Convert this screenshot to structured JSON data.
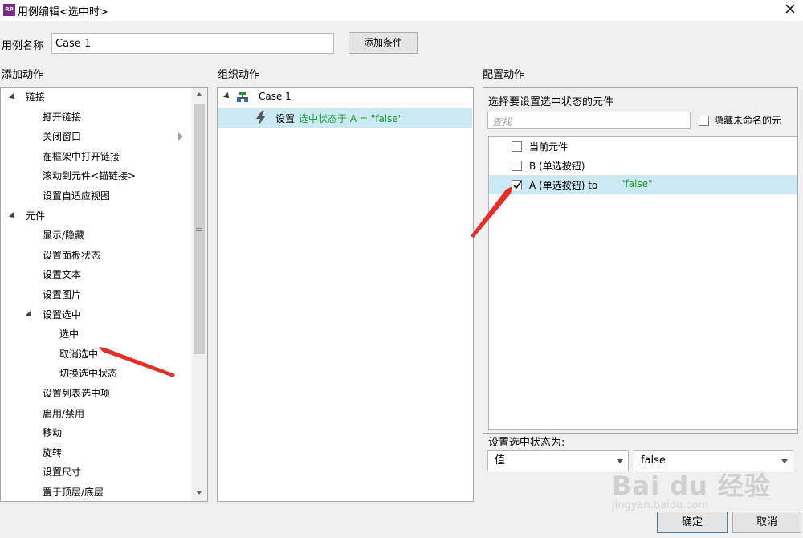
{
  "window": {
    "icon_text": "RP",
    "title": "用例编辑<选中时>",
    "close_label": "✕"
  },
  "case_name": {
    "label": "用例名称",
    "value": "Case 1",
    "add_condition_label": "添加条件"
  },
  "add_actions": {
    "title": "添加动作",
    "tree": [
      {
        "label": "链接",
        "level": 0,
        "state": "expanded"
      },
      {
        "label": "打开链接",
        "level": 1,
        "state": "collapsed"
      },
      {
        "label": "关闭窗口",
        "level": 1,
        "state": "none"
      },
      {
        "label": "在框架中打开链接",
        "level": 1,
        "state": "collapsed"
      },
      {
        "label": "滚动到元件<锚链接>",
        "level": 1,
        "state": "none"
      },
      {
        "label": "设置自适应视图",
        "level": 1,
        "state": "none"
      },
      {
        "label": "元件",
        "level": 0,
        "state": "expanded"
      },
      {
        "label": "显示/隐藏",
        "level": 1,
        "state": "collapsed"
      },
      {
        "label": "设置面板状态",
        "level": 1,
        "state": "none"
      },
      {
        "label": "设置文本",
        "level": 1,
        "state": "none"
      },
      {
        "label": "设置图片",
        "level": 1,
        "state": "none"
      },
      {
        "label": "设置选中",
        "level": 1,
        "state": "expanded"
      },
      {
        "label": "选中",
        "level": 2,
        "state": "none"
      },
      {
        "label": "取消选中",
        "level": 2,
        "state": "none"
      },
      {
        "label": "切换选中状态",
        "level": 2,
        "state": "none"
      },
      {
        "label": "设置列表选中项",
        "level": 1,
        "state": "none"
      },
      {
        "label": "启用/禁用",
        "level": 1,
        "state": "collapsed"
      },
      {
        "label": "移动",
        "level": 1,
        "state": "none"
      },
      {
        "label": "旋转",
        "level": 1,
        "state": "none"
      },
      {
        "label": "设置尺寸",
        "level": 1,
        "state": "none"
      },
      {
        "label": "置于顶层/底层",
        "level": 1,
        "state": "collapsed"
      }
    ]
  },
  "organize_actions": {
    "title": "组织动作",
    "case_label": "Case 1",
    "action_prefix": "设置",
    "action_detail": "选中状态于 A = \"false\""
  },
  "configure_actions": {
    "title": "配置动作",
    "subtitle": "选择要设置选中状态的元件",
    "search_placeholder": "查找",
    "hide_unnamed_label": "隐藏未命名的元",
    "widgets": [
      {
        "label": "当前元件",
        "detail": "",
        "checked": false
      },
      {
        "label": "B (单选按钮)",
        "detail": "",
        "checked": false
      },
      {
        "label": "A (单选按钮) to ",
        "detail": "\"false\"",
        "checked": true
      }
    ],
    "set_state_label": "设置选中状态为:",
    "value_type": "值",
    "value": "false"
  },
  "footer": {
    "ok_label": "确定",
    "cancel_label": "取消"
  },
  "watermark": {
    "brand": "Bai du 经验",
    "url": "jingyan.baidu.com"
  },
  "colors": {
    "selected_row": "#cce8f5",
    "green_text": "#1a9a2a",
    "arrow_red": "#e0302a",
    "icon_purple": "#7b2a8c"
  }
}
